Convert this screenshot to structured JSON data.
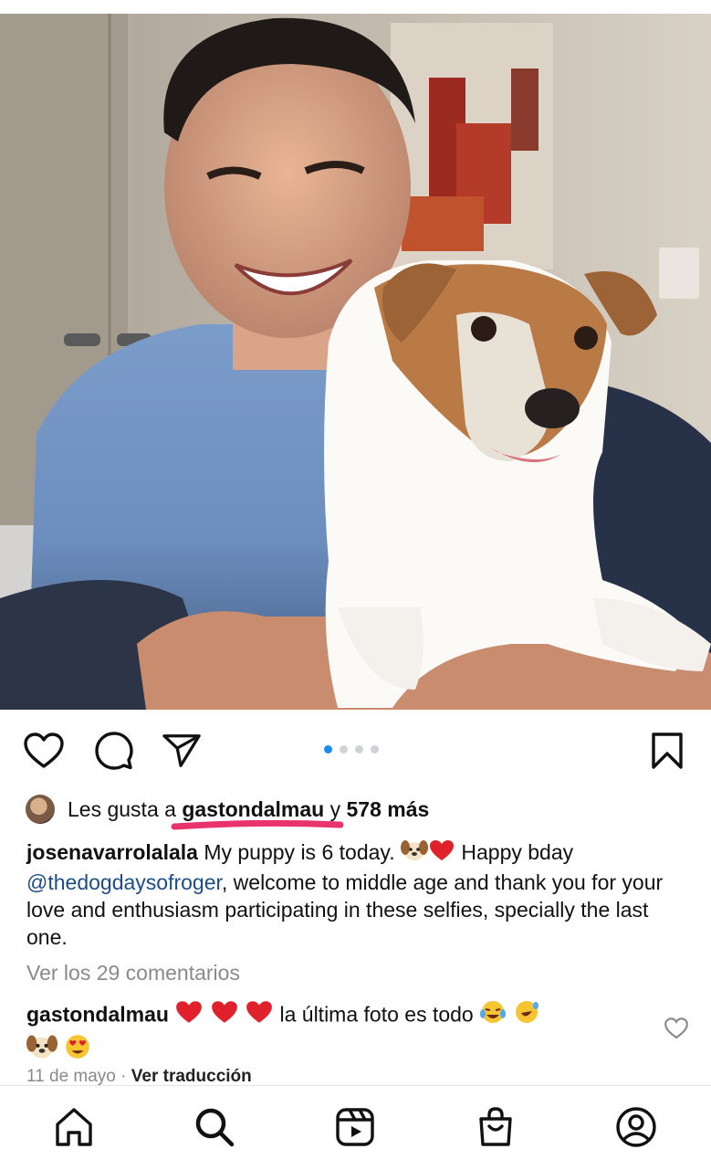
{
  "post": {
    "carousel": {
      "total": 4,
      "active_index": 0
    },
    "likes": {
      "prefix": "Les gusta a",
      "user": "gastondalmau",
      "connector": "y",
      "others": "578 más"
    },
    "caption": {
      "username": "josenavarrolalala",
      "text_part1": "My puppy is 6 today.",
      "text_part2": "Happy bday",
      "mention": "@thedogdaysofroger",
      "text_part3": ", welcome to middle age and thank you for your love and enthusiasm participating in these selfies, specially the last one."
    },
    "view_comments": "Ver los 29 comentarios",
    "top_comment": {
      "username": "gastondalmau",
      "text": "la última foto es todo"
    },
    "date": "11 de mayo",
    "separator": "·",
    "translate": "Ver traducción"
  },
  "icons": {
    "like": "heart-icon",
    "comment": "comment-bubble-icon",
    "share": "paper-plane-icon",
    "save": "bookmark-icon",
    "nav": [
      "home-icon",
      "search-icon",
      "reels-icon",
      "shop-icon",
      "profile-icon"
    ]
  },
  "colors": {
    "carousel_active": "#1a8cf0",
    "mention": "#1d4d88",
    "highlight_underline": "#e8336c"
  }
}
